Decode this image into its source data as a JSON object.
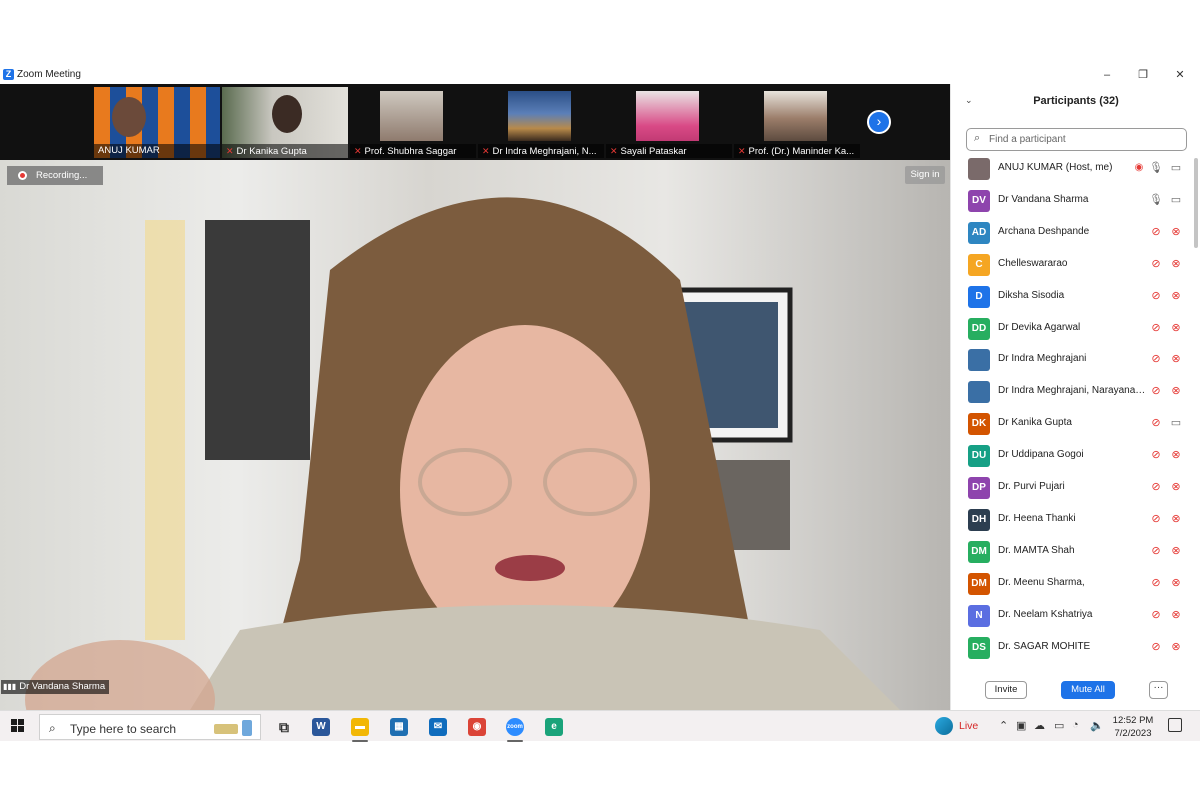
{
  "window": {
    "title": "Zoom Meeting",
    "minimize_glyph": "–",
    "maximize_glyph": "❐",
    "close_glyph": "✕"
  },
  "thumbnails": [
    {
      "name": "ANUJ KUMAR",
      "muted": false
    },
    {
      "name": "Dr Kanika Gupta",
      "muted": true
    },
    {
      "name": "Prof. Shubhra Saggar",
      "muted": true
    },
    {
      "name": "Dr Indra Meghrajani, N...",
      "muted": true
    },
    {
      "name": "Sayali Pataskar",
      "muted": true
    },
    {
      "name": "Prof. (Dr.) Maninder Ka...",
      "muted": true
    }
  ],
  "next_glyph": "›",
  "main_video": {
    "recording_label": "Recording...",
    "sign_in_label": "Sign in",
    "speaker_name": "Dr Vandana Sharma"
  },
  "panel": {
    "title": "Participants (32)",
    "collapse_glyph": "⌄",
    "search_placeholder": "Find a participant",
    "invite_label": "Invite",
    "mute_all_label": "Mute All",
    "more_label": "···",
    "participants": [
      {
        "initials": "",
        "name": "ANUJ KUMAR (Host, me)",
        "color": "#7a6a6a",
        "recording": true,
        "mic": "on",
        "cam": "on"
      },
      {
        "initials": "DV",
        "name": "Dr Vandana Sharma",
        "color": "#8e44ad",
        "recording": false,
        "mic": "on",
        "cam": "on"
      },
      {
        "initials": "AD",
        "name": "Archana Deshpande",
        "color": "#2e86c1",
        "recording": false,
        "mic": "off",
        "cam": "off"
      },
      {
        "initials": "C",
        "name": "Chelleswararao",
        "color": "#f5a623",
        "recording": false,
        "mic": "off",
        "cam": "off"
      },
      {
        "initials": "D",
        "name": "Diksha Sisodia",
        "color": "#1e73e8",
        "recording": false,
        "mic": "off",
        "cam": "off"
      },
      {
        "initials": "DD",
        "name": "Dr Devika Agarwal",
        "color": "#27ae60",
        "recording": false,
        "mic": "off",
        "cam": "off"
      },
      {
        "initials": "",
        "name": "Dr Indra Meghrajani",
        "color": "#3a6fa5",
        "recording": false,
        "mic": "off",
        "cam": "off"
      },
      {
        "initials": "",
        "name": "Dr Indra Meghrajani, Narayana B...",
        "color": "#3a6fa5",
        "recording": false,
        "mic": "off",
        "cam": "off"
      },
      {
        "initials": "DK",
        "name": "Dr Kanika Gupta",
        "color": "#d35400",
        "recording": false,
        "mic": "off",
        "cam": "on"
      },
      {
        "initials": "DU",
        "name": "Dr Uddipana Gogoi",
        "color": "#16a085",
        "recording": false,
        "mic": "off",
        "cam": "off"
      },
      {
        "initials": "DP",
        "name": "Dr. Purvi Pujari",
        "color": "#8e44ad",
        "recording": false,
        "mic": "off",
        "cam": "off"
      },
      {
        "initials": "DH",
        "name": "Dr. Heena Thanki",
        "color": "#2c3e50",
        "recording": false,
        "mic": "off",
        "cam": "off"
      },
      {
        "initials": "DM",
        "name": "Dr. MAMTA Shah",
        "color": "#27ae60",
        "recording": false,
        "mic": "off",
        "cam": "off"
      },
      {
        "initials": "DM",
        "name": "Dr. Meenu Sharma,",
        "color": "#d35400",
        "recording": false,
        "mic": "off",
        "cam": "off"
      },
      {
        "initials": "N",
        "name": "Dr. Neelam Kshatriya",
        "color": "#5b6ee1",
        "recording": false,
        "mic": "off",
        "cam": "off"
      },
      {
        "initials": "DS",
        "name": "Dr. SAGAR MOHITE",
        "color": "#27ae60",
        "recording": false,
        "mic": "off",
        "cam": "off"
      }
    ]
  },
  "taskbar": {
    "search_placeholder": "Type here to search",
    "apps": [
      {
        "name": "task-view",
        "glyph": "⧉",
        "color": "#444444",
        "active": false
      },
      {
        "name": "word",
        "glyph": "W",
        "color": "#2b579a",
        "active": false
      },
      {
        "name": "file-explorer",
        "glyph": "▬",
        "color": "#f2b705",
        "active": true
      },
      {
        "name": "store",
        "glyph": "▦",
        "color": "#1f6fb2",
        "active": false
      },
      {
        "name": "mail",
        "glyph": "✉",
        "color": "#0f6cbd",
        "active": false
      },
      {
        "name": "chrome",
        "glyph": "◉",
        "color": "#db4437",
        "active": false
      },
      {
        "name": "zoom",
        "glyph": "zoom",
        "color": "#2d8cff",
        "active": true
      },
      {
        "name": "edge",
        "glyph": "e",
        "color": "#1aa37a",
        "active": false
      }
    ],
    "live_label": "Live",
    "time": "12:52 PM",
    "date": "7/2/2023"
  }
}
